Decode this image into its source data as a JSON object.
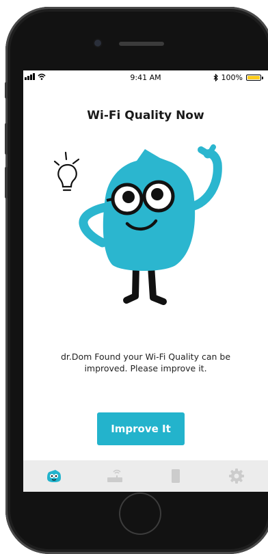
{
  "status_bar": {
    "time": "9:41 AM",
    "battery_percent": "100%",
    "battery_level": 1.0
  },
  "screen": {
    "title": "Wi-Fi Quality Now",
    "message_line1": "dr.Dom Found your Wi-Fi Quality can be",
    "message_line2": "improved. Please improve it.",
    "action_button": "Improve It"
  },
  "tab_bar": {
    "items": [
      {
        "icon": "drdom-face-icon",
        "active": true
      },
      {
        "icon": "router-icon",
        "active": false
      },
      {
        "icon": "phone-device-icon",
        "active": false
      },
      {
        "icon": "gear-icon",
        "active": false
      }
    ]
  },
  "colors": {
    "accent": "#23b3cc",
    "mascot": "#2bb6cf",
    "tab_bar_bg": "#ececec",
    "inactive_icon": "#cccccc",
    "battery": "#ffcc1a"
  }
}
